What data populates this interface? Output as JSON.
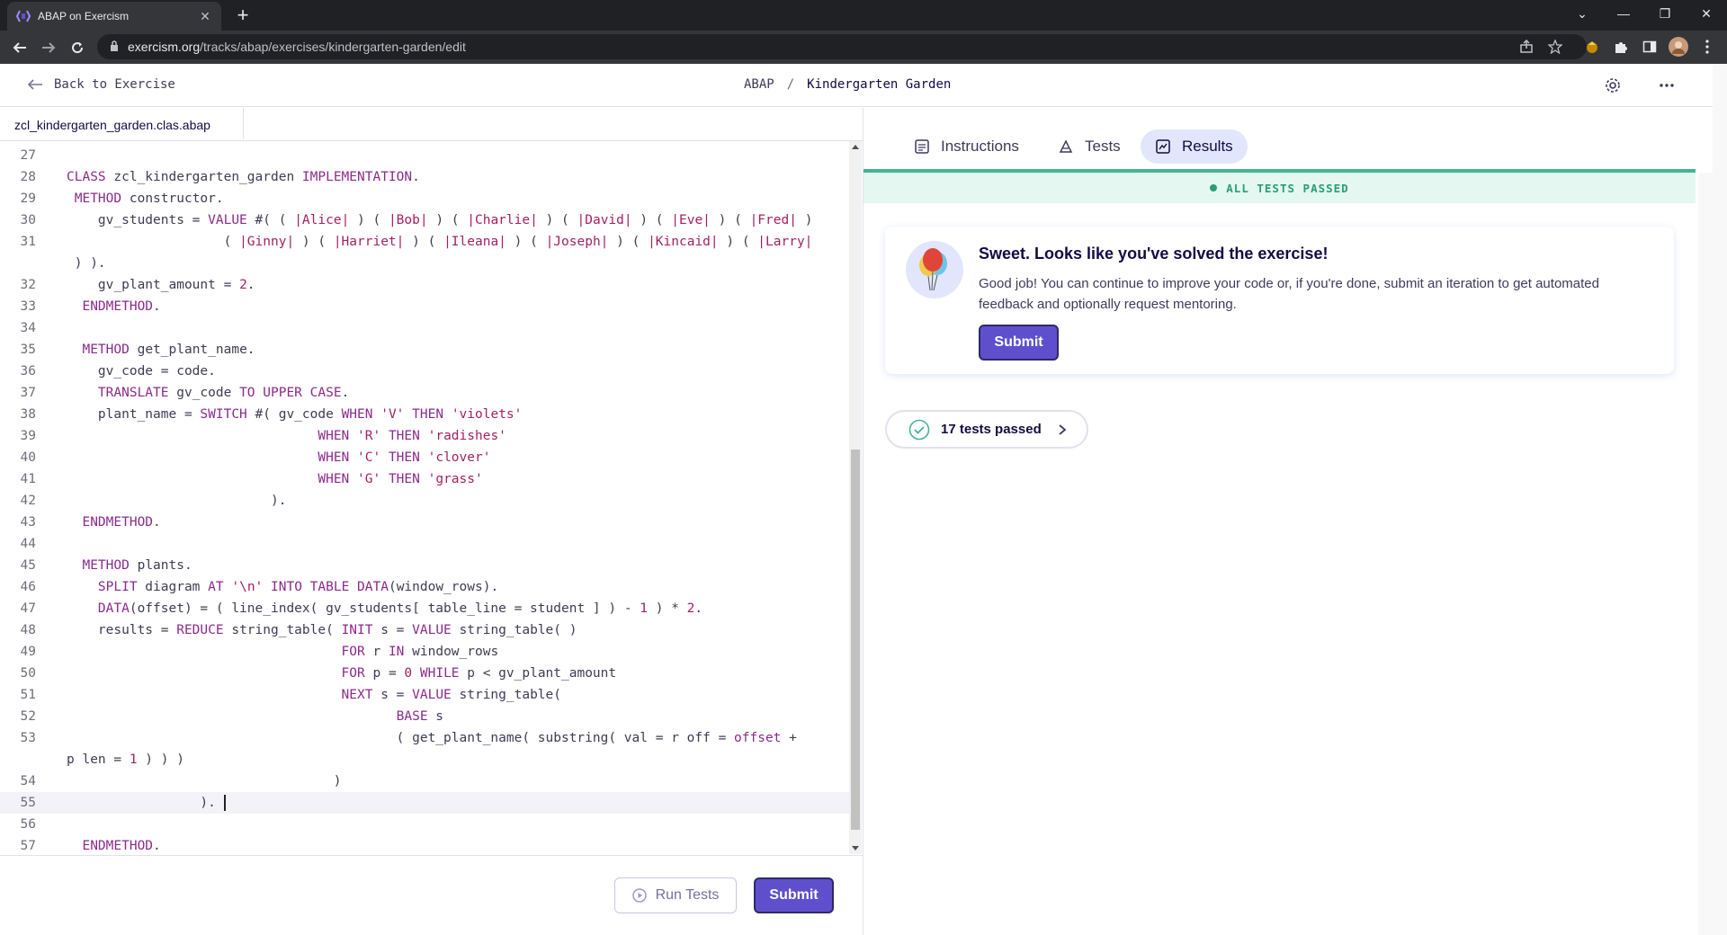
{
  "browser": {
    "tab_title": "ABAP on Exercism",
    "url_host": "exercism.org",
    "url_path": "/tracks/abap/exercises/kindergarten-garden/edit"
  },
  "topnav": {
    "back_label": "Back to Exercise",
    "track": "ABAP",
    "separator": "/",
    "exercise": "Kindergarten Garden"
  },
  "editor": {
    "filename": "zcl_kindergarten_garden.clas.abap",
    "active_line": "55",
    "lines": [
      {
        "n": "27",
        "html": ""
      },
      {
        "n": "28",
        "html": "<span class=\"kw\">CLASS</span> zcl_kindergarten_garden <span class=\"kw\">IMPLEMENTATION</span>."
      },
      {
        "n": "29",
        "html": " <span class=\"kw\">METHOD</span> constructor."
      },
      {
        "n": "30",
        "html": "    gv_students = <span class=\"kw\">VALUE</span> #( ( <span class=\"str\">|Alice|</span> ) ( <span class=\"str\">|Bob|</span> ) ( <span class=\"str\">|Charlie|</span> ) ( <span class=\"str\">|David|</span> ) ( <span class=\"str\">|Eve|</span> ) ( <span class=\"str\">|Fred|</span> )"
      },
      {
        "n": "31",
        "html": "                    ( <span class=\"str\">|Ginny|</span> ) ( <span class=\"str\">|Harriet|</span> ) ( <span class=\"str\">|Ileana|</span> ) ( <span class=\"str\">|Joseph|</span> ) ( <span class=\"str\">|Kincaid|</span> ) ( <span class=\"str\">|Larry|</span>"
      },
      {
        "n": "",
        "html": " ) )."
      },
      {
        "n": "32",
        "html": "    gv_plant_amount = <span class=\"num\">2</span>."
      },
      {
        "n": "33",
        "html": "  <span class=\"kw\">ENDMETHOD</span>."
      },
      {
        "n": "34",
        "html": ""
      },
      {
        "n": "35",
        "html": "  <span class=\"kw\">METHOD</span> get_plant_name."
      },
      {
        "n": "36",
        "html": "    gv_code = code."
      },
      {
        "n": "37",
        "html": "    <span class=\"kw\">TRANSLATE</span> gv_code <span class=\"kw\">TO UPPER CASE</span>."
      },
      {
        "n": "38",
        "html": "    plant_name = <span class=\"kw\">SWITCH</span> #( gv_code <span class=\"kw\">WHEN</span> <span class=\"str\">'V'</span> <span class=\"kw\">THEN</span> <span class=\"str\">'violets'</span>"
      },
      {
        "n": "39",
        "html": "                                <span class=\"kw\">WHEN</span> <span class=\"str\">'R'</span> <span class=\"kw\">THEN</span> <span class=\"str\">'radishes'</span>"
      },
      {
        "n": "40",
        "html": "                                <span class=\"kw\">WHEN</span> <span class=\"str\">'C'</span> <span class=\"kw\">THEN</span> <span class=\"str\">'clover'</span>"
      },
      {
        "n": "41",
        "html": "                                <span class=\"kw\">WHEN</span> <span class=\"str\">'G'</span> <span class=\"kw\">THEN</span> <span class=\"str\">'grass'</span>"
      },
      {
        "n": "42",
        "html": "                          )."
      },
      {
        "n": "43",
        "html": "  <span class=\"kw\">ENDMETHOD</span>."
      },
      {
        "n": "44",
        "html": ""
      },
      {
        "n": "45",
        "html": "  <span class=\"kw\">METHOD</span> plants."
      },
      {
        "n": "46",
        "html": "    <span class=\"kw\">SPLIT</span> diagram <span class=\"kw\">AT</span> <span class=\"str\">'\\n'</span> <span class=\"kw\">INTO TABLE DATA</span>(window_rows)."
      },
      {
        "n": "47",
        "html": "    <span class=\"kw\">DATA</span>(offset) = ( line_index( gv_students[ table_line = student ] ) - <span class=\"num\">1</span> ) * <span class=\"num\">2</span>."
      },
      {
        "n": "48",
        "html": "    results = <span class=\"kw\">REDUCE</span> string_table( <span class=\"kw\">INIT</span> s = <span class=\"kw\">VALUE</span> string_table( )"
      },
      {
        "n": "49",
        "html": "                                   <span class=\"kw\">FOR</span> r <span class=\"kw\">IN</span> window_rows"
      },
      {
        "n": "50",
        "html": "                                   <span class=\"kw\">FOR</span> p = <span class=\"num\">0</span> <span class=\"kw\">WHILE</span> p &lt; gv_plant_amount"
      },
      {
        "n": "51",
        "html": "                                   <span class=\"kw\">NEXT</span> s = <span class=\"kw\">VALUE</span> string_table("
      },
      {
        "n": "52",
        "html": "                                          <span class=\"kw\">BASE</span> s"
      },
      {
        "n": "53",
        "html": "                                          ( get_plant_name( substring( val = r off = <span class=\"kw\">offset</span> +"
      },
      {
        "n": "",
        "html": "p len = <span class=\"num\">1</span> ) ) )"
      },
      {
        "n": "54",
        "html": "                                  )"
      },
      {
        "n": "55",
        "html": "                 ). "
      },
      {
        "n": "56",
        "html": ""
      },
      {
        "n": "57",
        "html": "  <span class=\"kw\">ENDMETHOD</span>."
      }
    ]
  },
  "editor_footer": {
    "run_tests_label": "Run Tests",
    "submit_label": "Submit"
  },
  "results_pane": {
    "tabs": [
      {
        "label": "Instructions",
        "icon": "instructions-icon"
      },
      {
        "label": "Tests",
        "icon": "tests-icon"
      },
      {
        "label": "Results",
        "icon": "results-icon"
      }
    ],
    "active_tab": "Results",
    "status_banner": "ALL TESTS PASSED",
    "success_heading": "Sweet. Looks like you've solved the exercise!",
    "success_body": "Good job! You can continue to improve your code or, if you're done, submit an iteration to get automated feedback and optionally request mentoring.",
    "card_submit_label": "Submit",
    "tests_passed_label": "17 tests passed"
  },
  "colors": {
    "accent": "#604fcd",
    "success": "#43b593",
    "keyword": "#8b2a8b",
    "string": "#a31f64"
  }
}
